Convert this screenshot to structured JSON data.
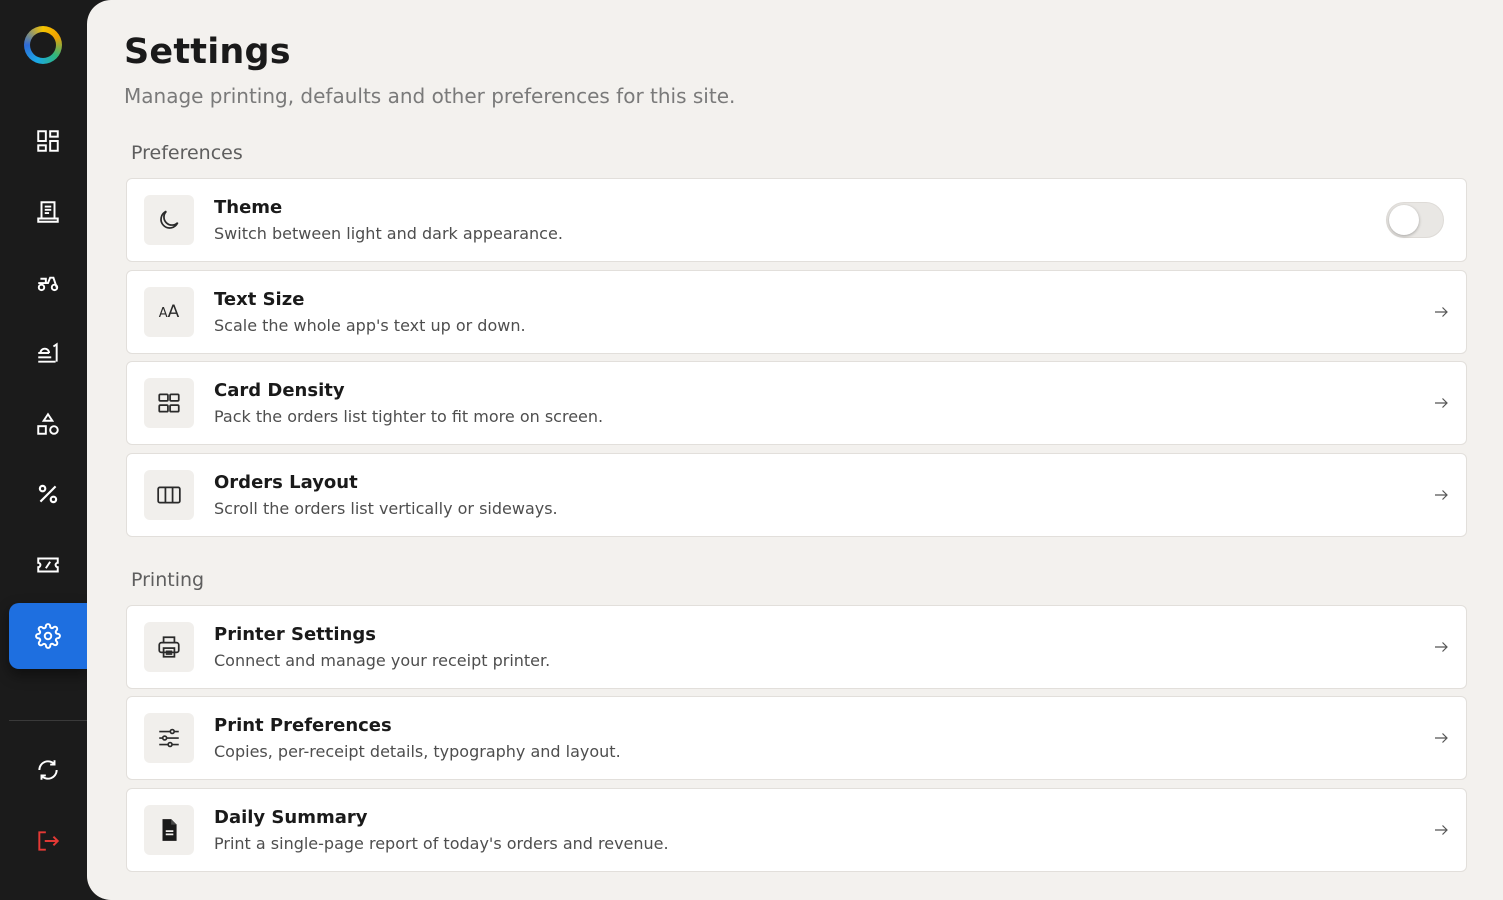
{
  "page": {
    "title": "Settings",
    "subtitle": "Manage printing, defaults and other preferences for this site."
  },
  "sidebar": {
    "items": [
      {
        "icon": "dashboard-icon",
        "active": false
      },
      {
        "icon": "receipt-icon",
        "active": false
      },
      {
        "icon": "delivery-scooter-icon",
        "active": false
      },
      {
        "icon": "menu-food-icon",
        "active": false
      },
      {
        "icon": "shapes-categories-icon",
        "active": false
      },
      {
        "icon": "percent-discount-icon",
        "active": false
      },
      {
        "icon": "voucher-ticket-icon",
        "active": false
      },
      {
        "icon": "gear-icon",
        "active": true
      }
    ],
    "bottom_items": [
      {
        "icon": "sync-icon"
      },
      {
        "icon": "logout-icon",
        "color": "#e53935"
      }
    ],
    "active_color": "#1e6fe0"
  },
  "sections": {
    "preferences": {
      "label": "Preferences",
      "cards": [
        {
          "icon": "moon-icon",
          "title": "Theme",
          "description": "Switch between light and dark appearance.",
          "control": "toggle",
          "toggle_on": false
        },
        {
          "icon": "text-size-icon",
          "icon_text": "AA",
          "title": "Text Size",
          "description": "Scale the whole app's text up or down.",
          "control": "arrow"
        },
        {
          "icon": "grid-icon",
          "title": "Card Density",
          "description": "Pack the orders list tighter to fit more on screen.",
          "control": "arrow"
        },
        {
          "icon": "columns-icon",
          "title": "Orders Layout",
          "description": "Scroll the orders list vertically or sideways.",
          "control": "arrow"
        }
      ]
    },
    "printing": {
      "label": "Printing",
      "cards": [
        {
          "icon": "printer-icon",
          "title": "Printer Settings",
          "description": "Connect and manage your receipt printer.",
          "control": "arrow"
        },
        {
          "icon": "sliders-icon",
          "title": "Print Preferences",
          "description": "Copies, per-receipt details, typography and layout.",
          "control": "arrow"
        },
        {
          "icon": "document-icon",
          "title": "Daily Summary",
          "description": "Print a single-page report of today's orders and revenue.",
          "control": "arrow"
        }
      ]
    }
  }
}
